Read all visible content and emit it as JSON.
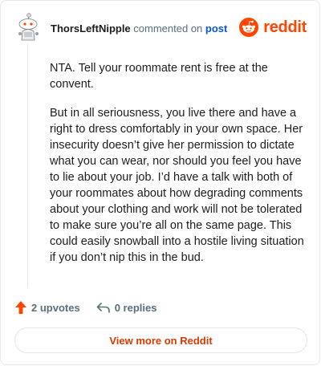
{
  "comment": {
    "username": "ThorsLeftNipple",
    "action_text": "commented on",
    "target_link": "post",
    "paragraphs": [
      "NTA. Tell your roommate rent is free at the convent.",
      "But in all seriousness, you live there and have a right to dress comfortably in your own space. Her insecurity doesn’t give her permission to dictate what you can wear, nor should you feel you have to lie about your job. I’d have a talk with both of your roommates about how degrading comments about your clothing and work will not be tolerated to make sure you’re all on the same page. This could easily snowball into a hostile living situation if you don’t nip this in the bud."
    ]
  },
  "brand": {
    "wordmark": "reddit",
    "color": "#ff4500",
    "icon": "reddit-snoo-icon"
  },
  "actions": {
    "upvotes_label": "2 upvotes",
    "replies_label": "0 replies",
    "upvote_color": "#ff4500"
  },
  "footer": {
    "view_label": "View more on Reddit"
  }
}
